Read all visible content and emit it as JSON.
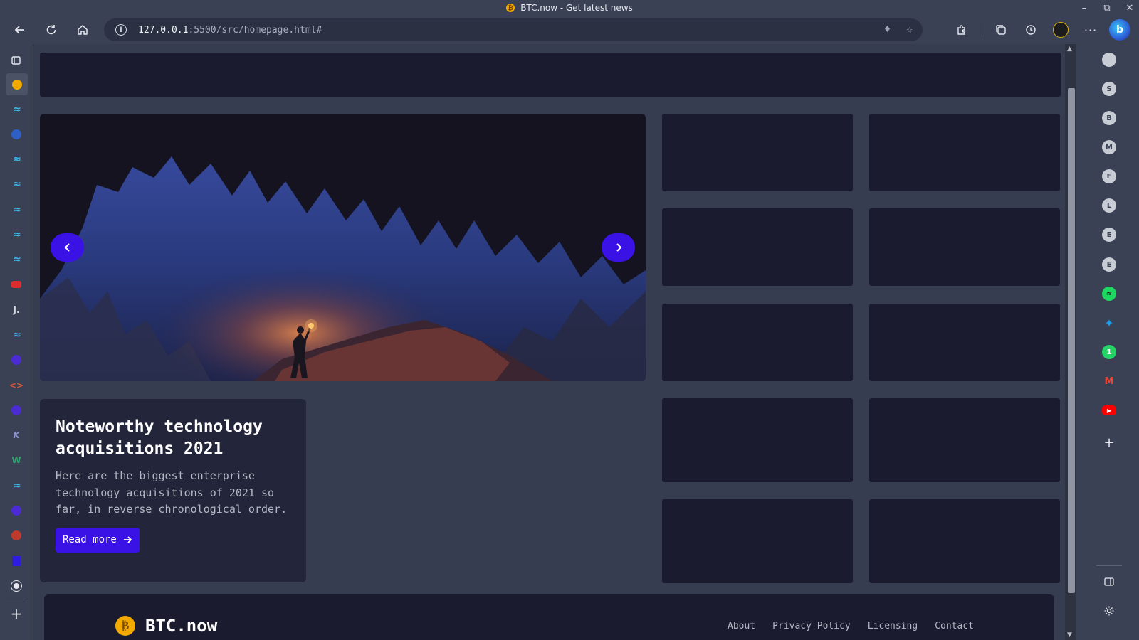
{
  "window": {
    "title": "BTC.now - Get latest news",
    "favicon": "₿"
  },
  "toolbar": {
    "url_host": "127.0.0.1",
    "url_rest": ":5500/src/homepage.html#"
  },
  "left_sidebar": {
    "icons": [
      "tab-actions-icon",
      "bitcoin-tab-icon",
      "tailwind-icon",
      "globe-icon",
      "tailwind-icon",
      "tailwind-icon",
      "tailwind-icon",
      "tailwind-icon",
      "tailwind-icon",
      "youtube-icon",
      "j-icon",
      "tailwind-icon",
      "shield-icon",
      "code-icon",
      "shield-icon",
      "k-icon",
      "w-icon",
      "tailwind-icon",
      "shield-icon",
      "helmet-icon",
      "flag-icon",
      "wordpress-icon",
      "add-icon"
    ],
    "j_label": "J.",
    "k_label": "K",
    "w_label": "W"
  },
  "right_sidebar": {
    "letters": [
      "S",
      "B",
      "M",
      "F",
      "L",
      "E",
      "E"
    ],
    "icons": [
      "spotify-icon",
      "twitter-icon",
      "whatsapp-icon",
      "gmail-icon",
      "youtube-icon",
      "add-icon",
      "split-screen-icon",
      "settings-icon"
    ],
    "whatsapp_label": "1"
  },
  "article": {
    "title": "Noteworthy technology acquisitions 2021",
    "body": "Here are the biggest enterprise technology acquisitions of 2021 so far, in reverse chronological order.",
    "button": "Read more"
  },
  "footer": {
    "brand": "BTC.now",
    "links": [
      "About",
      "Privacy Policy",
      "Licensing",
      "Contact"
    ]
  },
  "colors": {
    "accent": "#3a12e6",
    "card": "#1a1b2e",
    "page": "#373d51"
  }
}
